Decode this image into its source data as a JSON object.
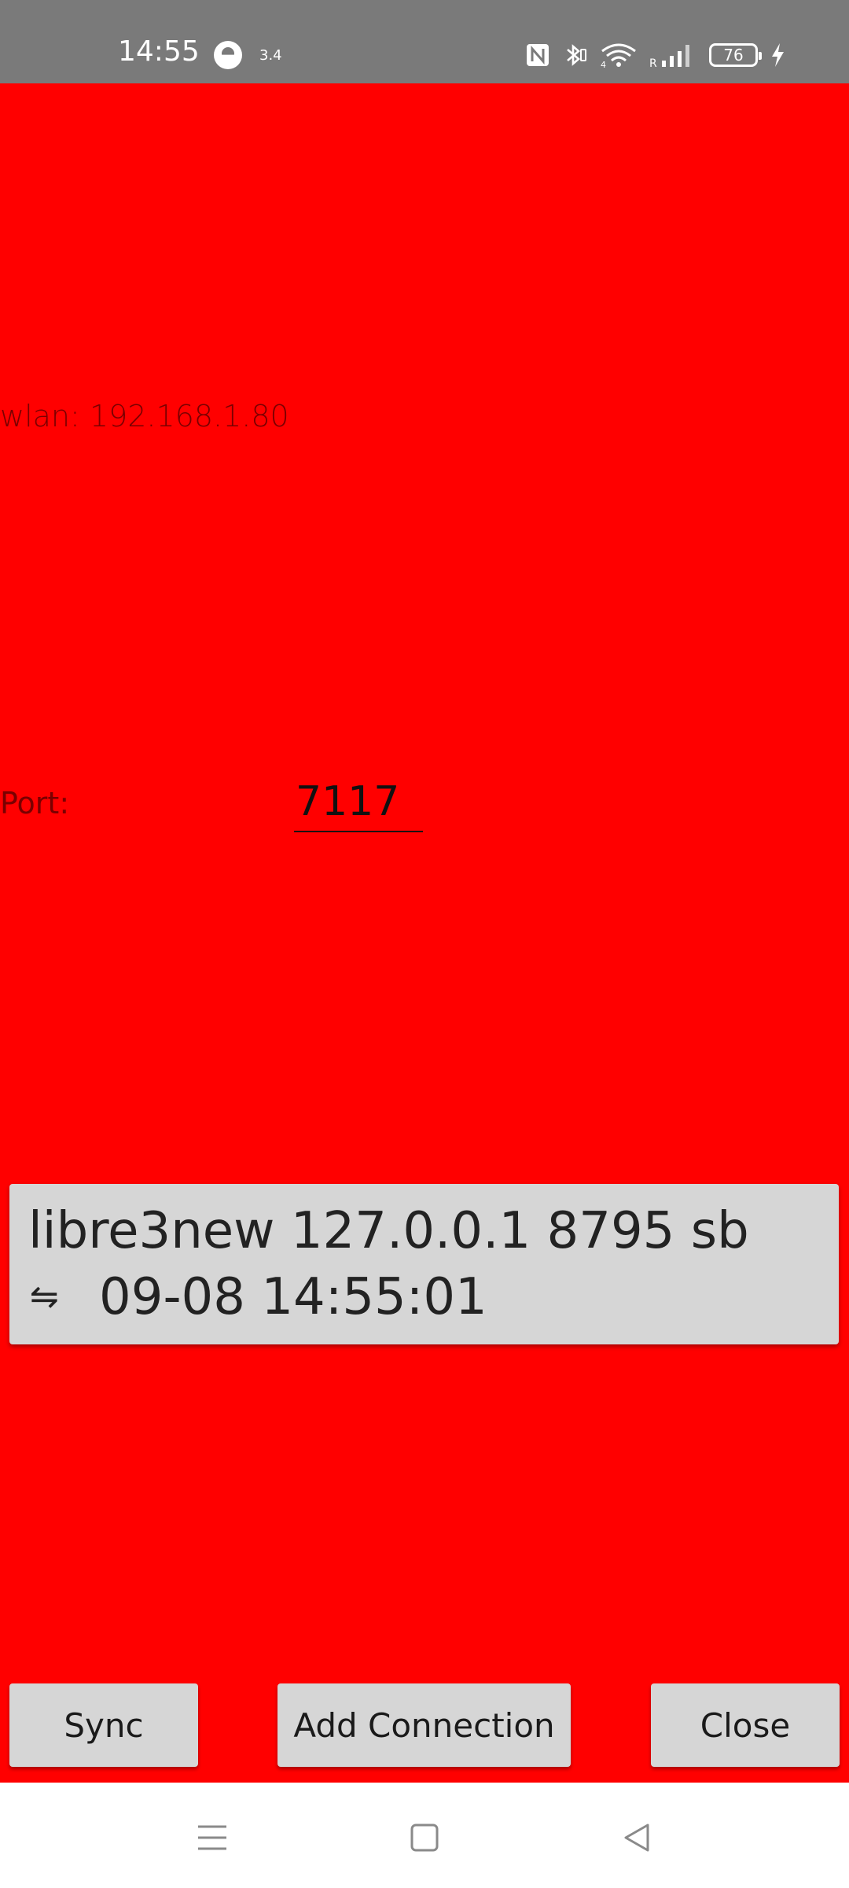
{
  "status_bar": {
    "time": "14:55",
    "data_speed": "3.4",
    "battery_level": "76",
    "icons": [
      "do-not-disturb-icon",
      "nfc-icon",
      "bluetooth-icon",
      "wifi-icon",
      "signal-icon",
      "battery-icon",
      "charging-icon"
    ]
  },
  "network": {
    "wlan_text": "wlan: 192.168.1.80"
  },
  "port": {
    "label": "Port:",
    "value": "7117"
  },
  "connections": [
    {
      "line1": "libre3new 127.0.0.1 8795 sb",
      "sync_symbol": "⇋",
      "timestamp": "09-08 14:55:01"
    }
  ],
  "buttons": {
    "sync": "Sync",
    "add_connection": "Add Connection",
    "close": "Close"
  },
  "navigation": {
    "icons": [
      "menu-icon",
      "home-icon",
      "back-icon"
    ]
  },
  "colors": {
    "background": "#ff0000",
    "status_bar": "#7a7a7a",
    "card": "#d6d6d6"
  }
}
